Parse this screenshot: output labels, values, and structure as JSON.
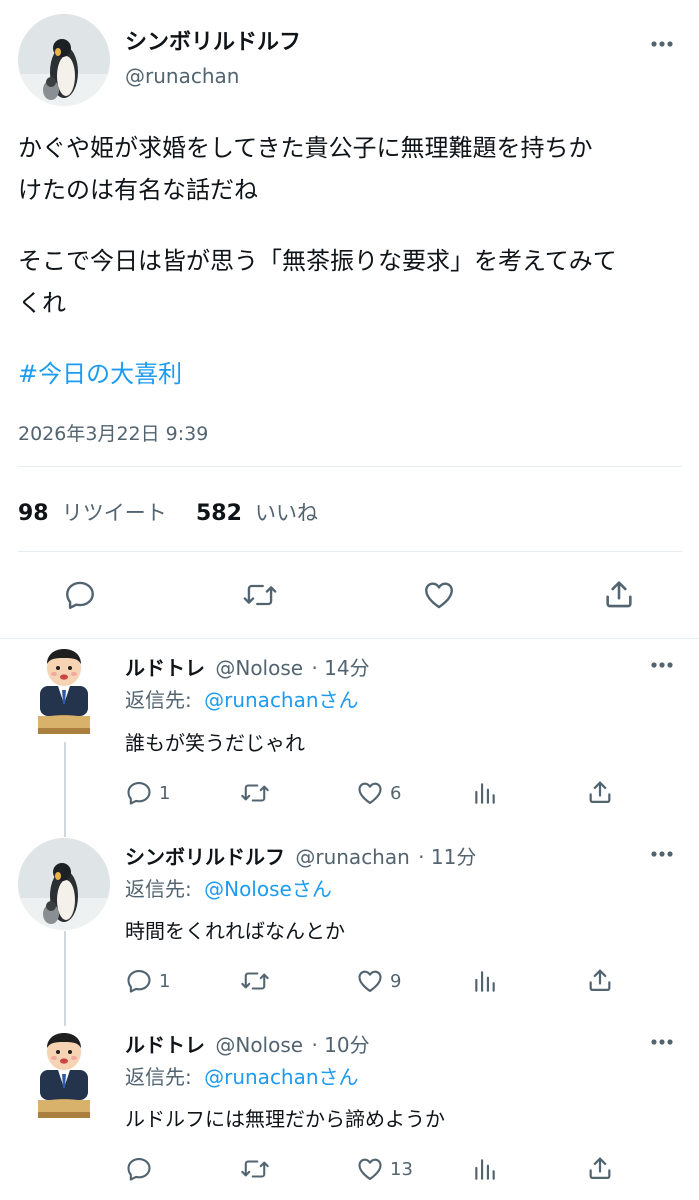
{
  "main_tweet": {
    "display_name": "シンボリルドルフ",
    "handle": "@runachan",
    "text_line1": "かぐや姫が求婚をしてきた貴公子に無理難題を持ちか",
    "text_line2": "けたのは有名な話だね",
    "text_line3": "そこで今日は皆が思う「無茶振りな要求」を考えてみて",
    "text_line4": "くれ",
    "hashtag": "#今日の大喜利",
    "timestamp": "2026年3月22日 9:39",
    "retweets": "98",
    "retweets_label": "リツイート",
    "likes": "582",
    "likes_label": "いいね"
  },
  "replies": [
    {
      "display_name": "ルドトレ",
      "handle": "@Nolose",
      "time": "· 14分",
      "reply_prefix": "返信先:",
      "reply_to": "@runachanさん",
      "text": "誰もが笑うだじゃれ",
      "reply_count": "1",
      "retweet_count": "",
      "like_count": "6"
    },
    {
      "display_name": "シンボリルドルフ",
      "handle": "@runachan",
      "time": "· 11分",
      "reply_prefix": "返信先:",
      "reply_to": "@Noloseさん",
      "text": "時間をくれればなんとか",
      "reply_count": "1",
      "retweet_count": "",
      "like_count": "9"
    },
    {
      "display_name": "ルドトレ",
      "handle": "@Nolose",
      "time": "· 10分",
      "reply_prefix": "返信先:",
      "reply_to": "@runachanさん",
      "text": "ルドルフには無理だから諦めようか",
      "reply_count": "",
      "retweet_count": "",
      "like_count": "13"
    }
  ],
  "colors": {
    "accent": "#1d9bf0",
    "muted": "#536471",
    "divider": "#e6ecf0"
  },
  "icons": [
    "more-icon",
    "reply-icon",
    "retweet-icon",
    "like-icon",
    "share-icon",
    "analytics-icon"
  ]
}
